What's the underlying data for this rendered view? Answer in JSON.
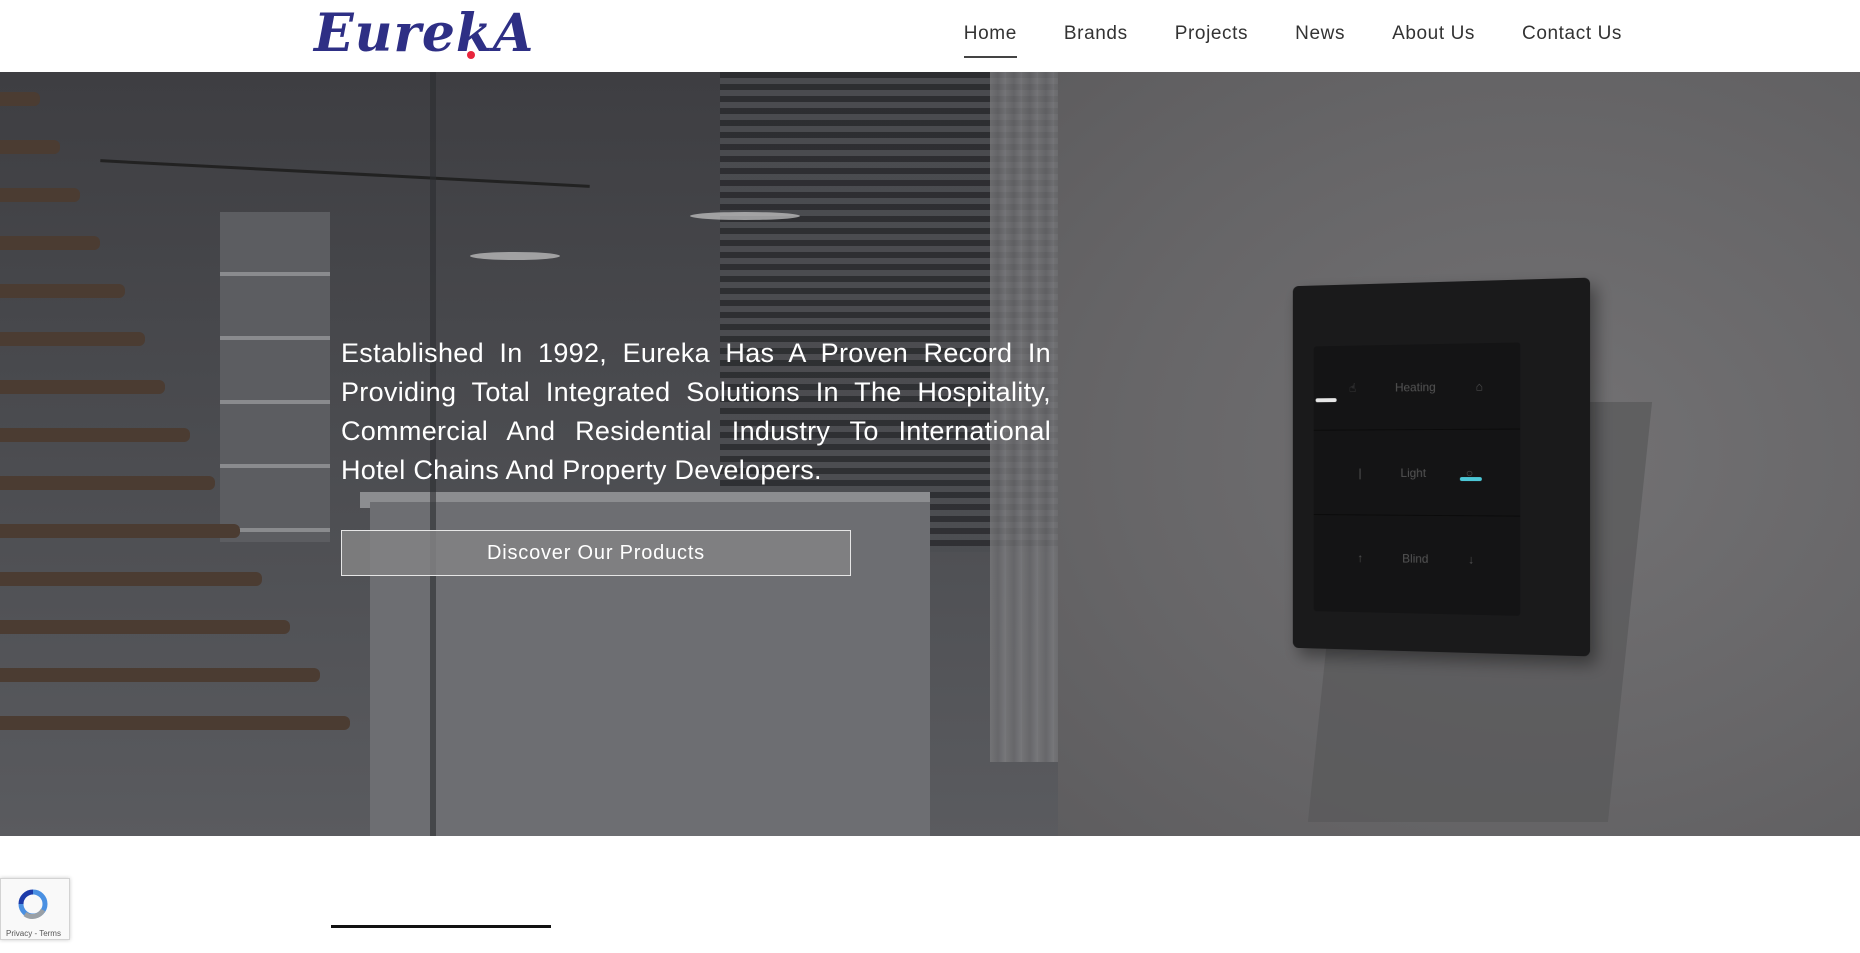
{
  "header": {
    "logo_text": "EurekA",
    "nav": [
      {
        "label": "Home",
        "active": true
      },
      {
        "label": "Brands",
        "active": false
      },
      {
        "label": "Projects",
        "active": false
      },
      {
        "label": "News",
        "active": false
      },
      {
        "label": "About Us",
        "active": false
      },
      {
        "label": "Contact Us",
        "active": false
      }
    ]
  },
  "hero": {
    "tagline": "Established In 1992, Eureka Has A Proven Record In Providing Total Integrated Solutions In The Hospitality, Commercial And Residential Industry To International Hotel Chains And Property Developers.",
    "cta_label": "Discover Our Products",
    "switch_labels": [
      "Heating",
      "Light",
      "Blind"
    ]
  },
  "recaptcha": {
    "terms": "Privacy - Terms"
  },
  "colors": {
    "brand": "#2e2f85",
    "brand_dot": "#e8253c",
    "led_white": "#e6e6e6",
    "led_cyan": "#4cc7d6"
  }
}
